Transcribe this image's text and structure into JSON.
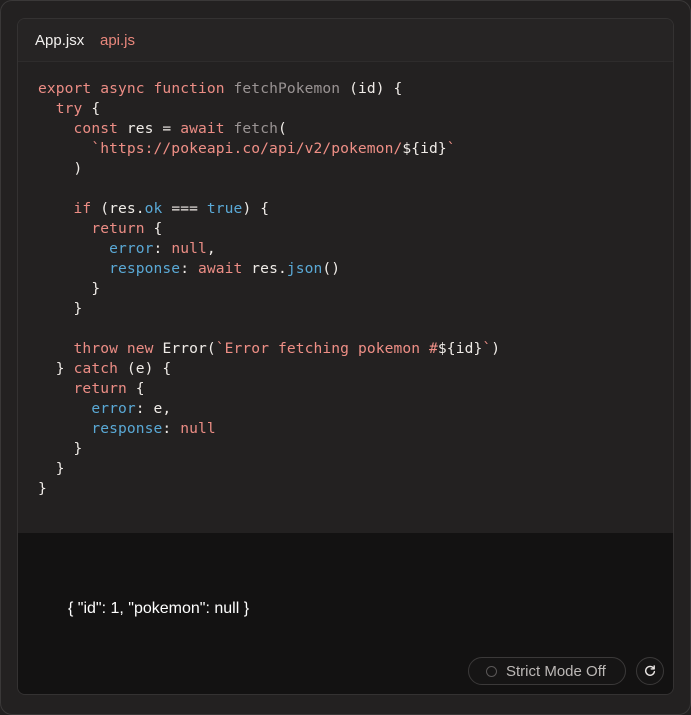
{
  "tabs": [
    {
      "label": "App.jsx",
      "color": "#f2f0ee"
    },
    {
      "label": "api.js",
      "color": "#e9877c"
    }
  ],
  "code": {
    "line1": {
      "kw1": "export",
      "kw2": "async",
      "kw3": "function",
      "fn": "fetchPokemon",
      "rest": "(id) {"
    },
    "line2": {
      "kw": "try",
      "rest": "{"
    },
    "line3": {
      "kw": "const",
      "mid": "res =",
      "kw2": "await",
      "fn": "fetch",
      "rest": "("
    },
    "line4": {
      "str": "`https://pokeapi.co/api/v2/pokemon/",
      "interp": "${id}",
      "tick": "`"
    },
    "line5": {
      "rest": ")"
    },
    "line7": {
      "kw": "if",
      "a": "(res.",
      "prop": "ok",
      "b": "===",
      "val": "true",
      "c": ") {"
    },
    "line8": {
      "kw": "return",
      "rest": "{"
    },
    "line9": {
      "prop": "error",
      "colon": ":",
      "val": "null",
      "comma": ","
    },
    "line10": {
      "prop": "response",
      "colon": ":",
      "kw": "await",
      "a": "res.",
      "fn": "json",
      "b": "()"
    },
    "line11": {
      "rest": "}"
    },
    "line12": {
      "rest": "}"
    },
    "line14": {
      "kw1": "throw",
      "kw2": "new",
      "cls": "Error(",
      "str": "`Error fetching pokemon #",
      "interp": "${id}",
      "tick": "`",
      "close": ")"
    },
    "line15": {
      "a": "}",
      "kw": "catch",
      "rest": "(e) {"
    },
    "line16": {
      "kw": "return",
      "rest": "{"
    },
    "line17": {
      "prop": "error",
      "colon": ":",
      "rest": "e,"
    },
    "line18": {
      "prop": "response",
      "colon": ":",
      "val": "null"
    },
    "line19": {
      "rest": "}"
    },
    "line20": {
      "rest": "}"
    },
    "line21": {
      "rest": "}"
    }
  },
  "output": {
    "text": "{ \"id\": 1, \"pokemon\": null }"
  },
  "controls": {
    "strict_mode_label": "Strict Mode Off",
    "refresh_icon": "refresh-icon"
  },
  "colors": {
    "keyword": "#ec8d85",
    "string": "#ef8f86",
    "property": "#5aa9d6",
    "function_name": "#9a9494",
    "background": "#232121"
  }
}
